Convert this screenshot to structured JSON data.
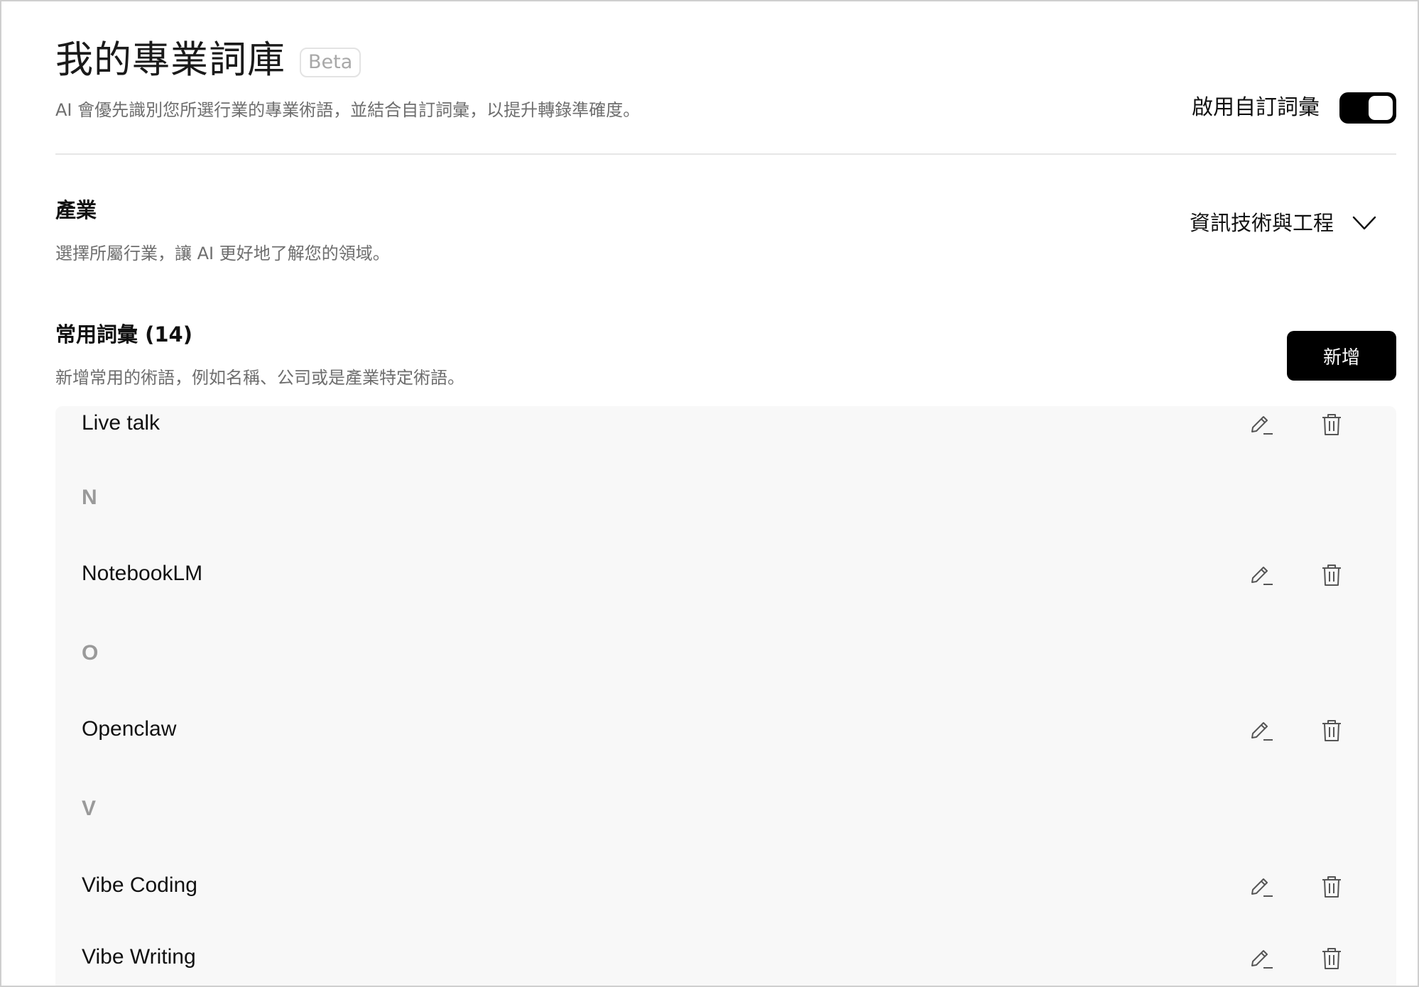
{
  "header": {
    "title": "我的專業詞庫",
    "badge": "Beta",
    "description": "AI 會優先識別您所選行業的專業術語，並結合自訂詞彙，以提升轉錄準確度。",
    "toggle_label": "啟用自訂詞彙",
    "toggle_on": true
  },
  "industry": {
    "title": "產業",
    "description": "選擇所屬行業，讓 AI 更好地了解您的領域。",
    "selected": "資訊技術與工程"
  },
  "vocab": {
    "title": "常用詞彙 (14)",
    "description": "新增常用的術語，例如名稱、公司或是產業特定術語。",
    "add_label": "新增",
    "groups": [
      {
        "letter": "",
        "terms": [
          "Live talk"
        ]
      },
      {
        "letter": "N",
        "terms": [
          "NotebookLM"
        ]
      },
      {
        "letter": "O",
        "terms": [
          "Openclaw"
        ]
      },
      {
        "letter": "V",
        "terms": [
          "Vibe Coding",
          "Vibe Writing"
        ]
      }
    ]
  },
  "icons": {
    "edit": "pencil-edit-icon",
    "delete": "trash-icon",
    "dropdown": "chevron-down-icon"
  },
  "colors": {
    "accent": "#000000",
    "panel_bg": "#f8f8f8",
    "muted_text": "#6e6e6e"
  }
}
